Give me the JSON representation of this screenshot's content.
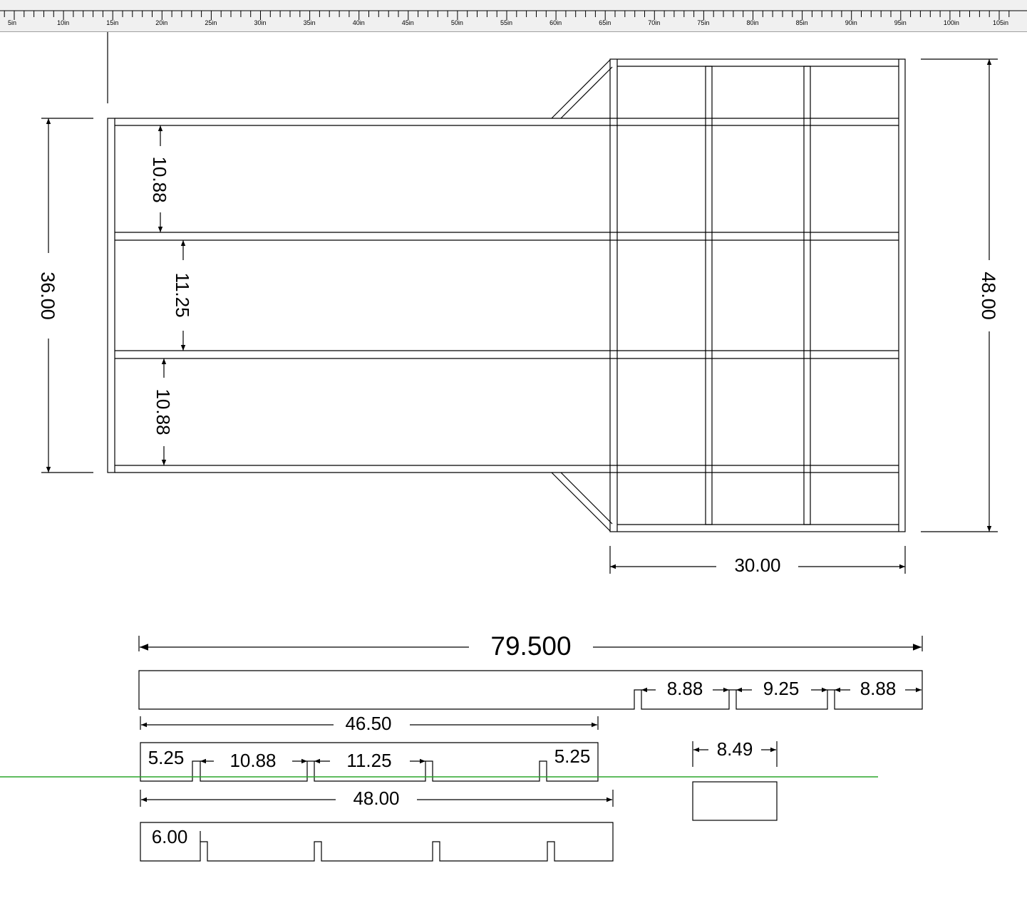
{
  "ruler": {
    "unit": "in",
    "labels": [
      "5in",
      "10in",
      "15in",
      "20in",
      "25in",
      "30in",
      "35in",
      "40in",
      "45in",
      "50in",
      "55in",
      "60in",
      "65in",
      "70in",
      "75in",
      "80in",
      "85in",
      "90in",
      "95in",
      "100in",
      "105in"
    ]
  },
  "drawing": {
    "line_color": "#000000",
    "guide_color": "#2aa52a",
    "top_view": {
      "overall_width": "36.00",
      "bay_1": "10.88",
      "bay_2": "11.25",
      "bay_3": "10.88",
      "rear_width": "48.00",
      "rear_depth": "30.00"
    },
    "parts": {
      "overall_length": "79.500",
      "seg_a": "8.88",
      "seg_b": "9.25",
      "seg_c": "8.88",
      "rail_length": "46.50",
      "rail_end_left": "5.25",
      "rail_bay_1": "10.88",
      "rail_bay_2": "11.25",
      "rail_end_right": "5.25",
      "block_width": "8.49",
      "cross_length": "48.00",
      "cross_end": "6.00"
    }
  }
}
